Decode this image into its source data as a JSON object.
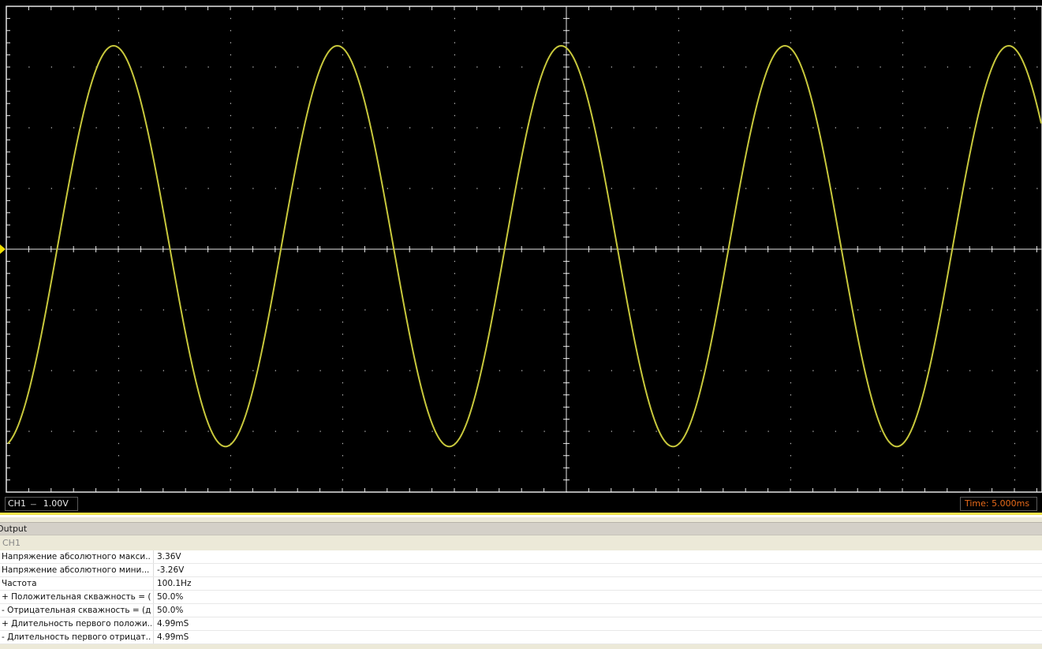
{
  "scope": {
    "colors": {
      "background": "#000000",
      "grid": "#c8c8c8",
      "trace": "#c8c83c",
      "trigger_marker": "#f0e000"
    },
    "grid_divisions": {
      "x": 10,
      "y": 8
    },
    "trace": {
      "channel": "CH1",
      "waveform": "sine",
      "volts_per_div": 1.0,
      "ms_per_div": 5.0,
      "period_ms": 9.99,
      "amplitude_v": 3.3,
      "offset_v": 0.05,
      "start_phase_deg": -80
    }
  },
  "status": {
    "channel_label": "CH1",
    "coupling_symbol": "---",
    "volts_div": "1.00V",
    "time_label": "Time: 5.000ms"
  },
  "panel": {
    "header": "Output",
    "group": "CH1",
    "measurements": [
      {
        "name": "Напряжение абсолютного макси...",
        "value": "3.36V"
      },
      {
        "name": "Напряжение абсолютного мини...",
        "value": "-3.26V"
      },
      {
        "name": "Частота",
        "value": "100.1Hz"
      },
      {
        "name": "+ Положительная скважность = (...",
        "value": "50.0%"
      },
      {
        "name": "- Отрицательная скважность = (д...",
        "value": "50.0%"
      },
      {
        "name": "+ Длительность первого положи...",
        "value": "4.99mS"
      },
      {
        "name": "- Длительность первого отрицат...",
        "value": "4.99mS"
      }
    ]
  }
}
